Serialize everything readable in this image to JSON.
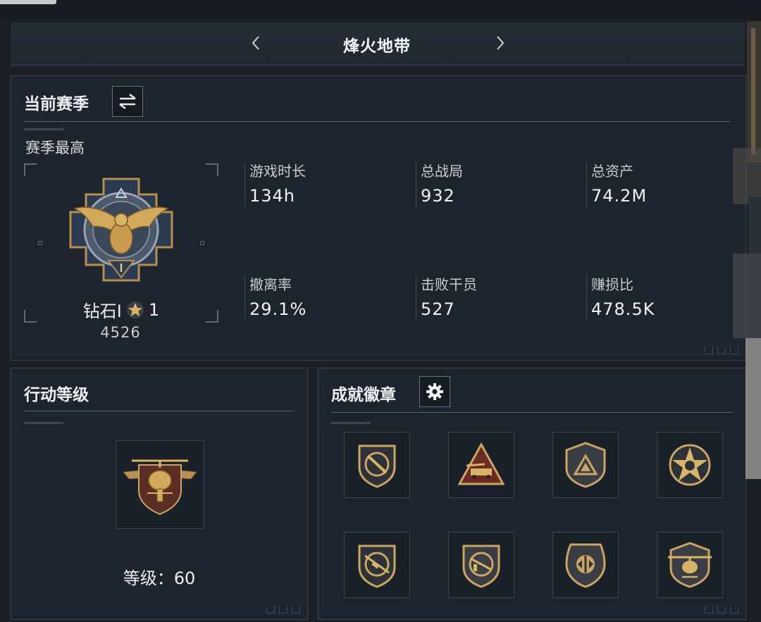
{
  "header": {
    "mode_title": "烽火地带"
  },
  "season": {
    "title": "当前赛季",
    "best_label": "赛季最高",
    "rank_name": "钻石I",
    "rank_stars": "1",
    "rank_score": "4526",
    "stats": [
      {
        "label": "游戏时长",
        "value": "134h"
      },
      {
        "label": "总战局",
        "value": "932"
      },
      {
        "label": "总资产",
        "value": "74.2M"
      },
      {
        "label": "撤离率",
        "value": "29.1%"
      },
      {
        "label": "击败干员",
        "value": "527"
      },
      {
        "label": "赚损比",
        "value": "478.5K"
      }
    ]
  },
  "level": {
    "title": "行动等级",
    "level_text": "等级：60"
  },
  "badges": {
    "title": "成就徽章",
    "items": [
      {
        "icon": "shield-knife-icon"
      },
      {
        "icon": "triangle-vehicle-icon"
      },
      {
        "icon": "shield-triangle-icon"
      },
      {
        "icon": "star-skull-icon"
      },
      {
        "icon": "shield-rifle-icon"
      },
      {
        "icon": "shield-gun-icon"
      },
      {
        "icon": "shield-emblem-icon"
      },
      {
        "icon": "shield-helicopter-icon"
      }
    ]
  },
  "colors": {
    "background": "#1b2028",
    "panel": "#1e242d",
    "border": "#3a4350",
    "gold": "#c9a566"
  }
}
